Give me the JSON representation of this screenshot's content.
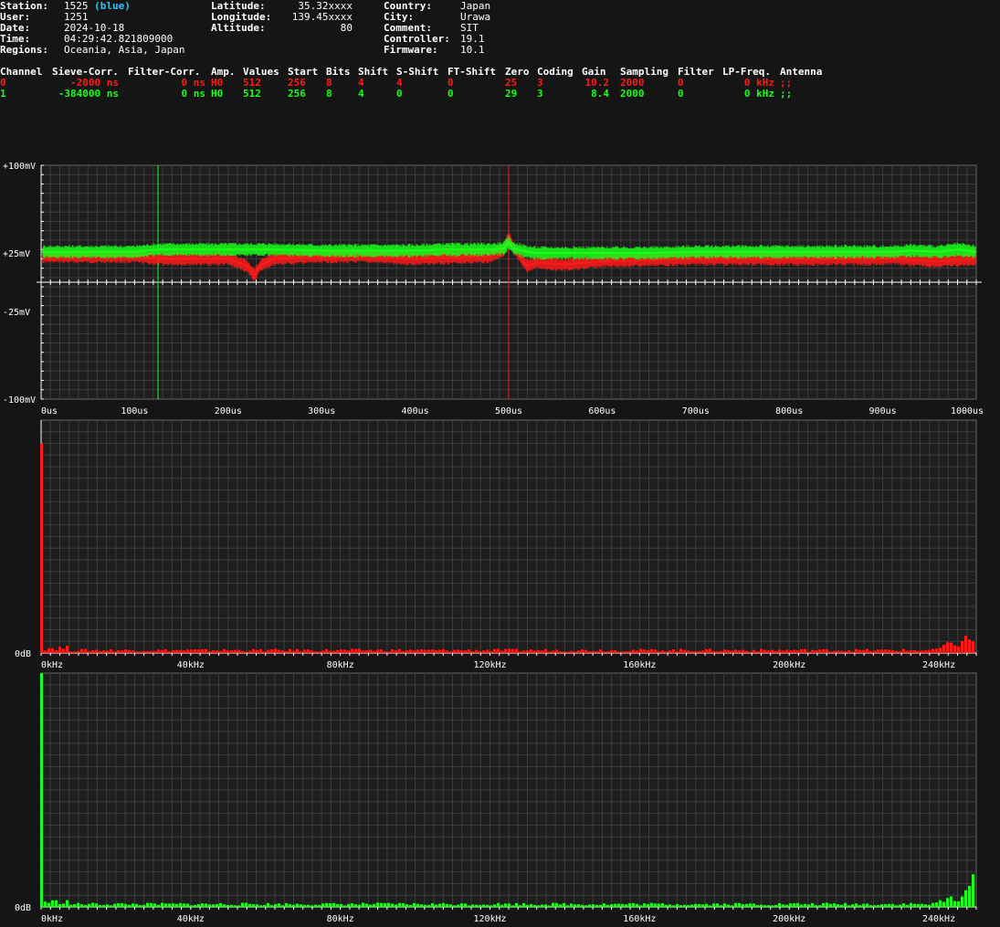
{
  "header": {
    "col1": [
      {
        "label": "Station:",
        "value": "1525",
        "extra": "(blue)"
      },
      {
        "label": "User:",
        "value": "1251"
      },
      {
        "label": "Date:",
        "value": "2024-10-18"
      },
      {
        "label": "Time:",
        "value": "04:29:42.821809000"
      },
      {
        "label": "Regions:",
        "value": "Oceania, Asia, Japan"
      }
    ],
    "col2": [
      {
        "label": "Latitude:",
        "value": "35.32xxxx"
      },
      {
        "label": "Longitude:",
        "value": "139.45xxxx"
      },
      {
        "label": "Altitude:",
        "value": "80"
      }
    ],
    "col3": [
      {
        "label": "Country:",
        "value": "Japan"
      },
      {
        "label": "City:",
        "value": "Urawa"
      },
      {
        "label": "Comment:",
        "value": "SIT"
      },
      {
        "label": "Controller:",
        "value": "19.1"
      },
      {
        "label": "Firmware:",
        "value": "10.1"
      }
    ]
  },
  "channels": {
    "headers": [
      "Channel",
      "Sieve-Corr.",
      "Filter-Corr.",
      "Amp.",
      "Values",
      "Start",
      "Bits",
      "Shift",
      "S-Shift",
      "FT-Shift",
      "Zero",
      "Coding",
      "Gain",
      "Sampling",
      "Filter",
      "LP-Freq.",
      "Antenna"
    ],
    "rows": [
      {
        "color": "#ff1a1a",
        "cells": [
          "0",
          "-2000 ns",
          "0 ns",
          "H0",
          "512",
          "256",
          "8",
          "4",
          "4",
          "0",
          "25",
          "3",
          "10.2",
          "2000",
          "0",
          "0 kHz",
          ";;"
        ]
      },
      {
        "color": "#1aff1a",
        "cells": [
          "1",
          "-384000 ns",
          "0 ns",
          "H0",
          "512",
          "256",
          "8",
          "4",
          "0",
          "0",
          "29",
          "3",
          "8.4",
          "2000",
          "0",
          "0 kHz",
          ";;"
        ]
      }
    ]
  },
  "chart_data": [
    {
      "type": "line",
      "x_unit": "us",
      "xlim": [
        0,
        1000
      ],
      "ylim": [
        -100,
        100
      ],
      "y_ticks": [
        "+100mV",
        "+25mV",
        "-25mV",
        "-100mV"
      ],
      "y_tick_values": [
        100,
        25,
        -25,
        -100
      ],
      "x_ticks": [
        "0us",
        "100us",
        "200us",
        "300us",
        "400us",
        "500us",
        "600us",
        "700us",
        "800us",
        "900us",
        "1000us"
      ],
      "x_tick_values": [
        0,
        100,
        200,
        300,
        400,
        500,
        600,
        700,
        800,
        900,
        1000
      ],
      "markers": [
        {
          "x": 125,
          "color": "#1aff1a"
        },
        {
          "x": 500,
          "color": "#ff1a1a"
        }
      ],
      "series": [
        {
          "color": "#ff1a1a",
          "x": [
            0,
            50,
            100,
            125,
            150,
            200,
            220,
            228,
            235,
            250,
            300,
            350,
            400,
            430,
            480,
            495,
            500,
            505,
            515,
            520,
            530,
            560,
            600,
            700,
            800,
            900,
            910,
            930,
            960,
            1000
          ],
          "y": [
            22,
            22,
            22,
            20,
            20,
            20,
            14,
            6,
            15,
            20,
            22,
            22,
            20,
            21,
            22,
            28,
            40,
            30,
            18,
            14,
            17,
            15,
            18,
            20,
            20,
            20,
            21,
            19,
            18,
            20
          ]
        },
        {
          "color": "#1aff1a",
          "x": [
            0,
            50,
            100,
            125,
            150,
            200,
            250,
            300,
            350,
            400,
            430,
            480,
            495,
            500,
            505,
            520,
            530,
            560,
            600,
            650,
            700,
            800,
            900,
            910,
            930,
            960,
            980,
            1000
          ],
          "y": [
            26,
            26,
            26,
            28,
            28,
            28,
            28,
            27,
            27,
            27,
            28,
            28,
            29,
            34,
            29,
            26,
            25,
            25,
            25,
            25,
            26,
            26,
            26,
            26,
            27,
            26,
            28,
            26
          ]
        }
      ],
      "band_series_amplitude": 6
    },
    {
      "type": "bar",
      "x_unit": "kHz",
      "xlim": [
        0,
        250
      ],
      "x_ticks": [
        "0kHz",
        "40kHz",
        "80kHz",
        "120kHz",
        "160kHz",
        "200kHz",
        "240kHz"
      ],
      "x_tick_values": [
        0,
        40,
        80,
        120,
        160,
        200,
        240
      ],
      "y_ticks": [
        "0dB"
      ],
      "color": "#ff1a1a",
      "peak_first": 0.9,
      "peak_last": 0.05,
      "floor": 0.012
    },
    {
      "type": "bar",
      "x_unit": "kHz",
      "xlim": [
        0,
        250
      ],
      "x_ticks": [
        "0kHz",
        "40kHz",
        "80kHz",
        "120kHz",
        "160kHz",
        "200kHz",
        "240kHz"
      ],
      "x_tick_values": [
        0,
        40,
        80,
        120,
        160,
        200,
        240
      ],
      "y_ticks": [
        "0dB"
      ],
      "color": "#1aff1a",
      "peak_first": 1.0,
      "peak_last": 0.14,
      "floor": 0.012
    }
  ]
}
